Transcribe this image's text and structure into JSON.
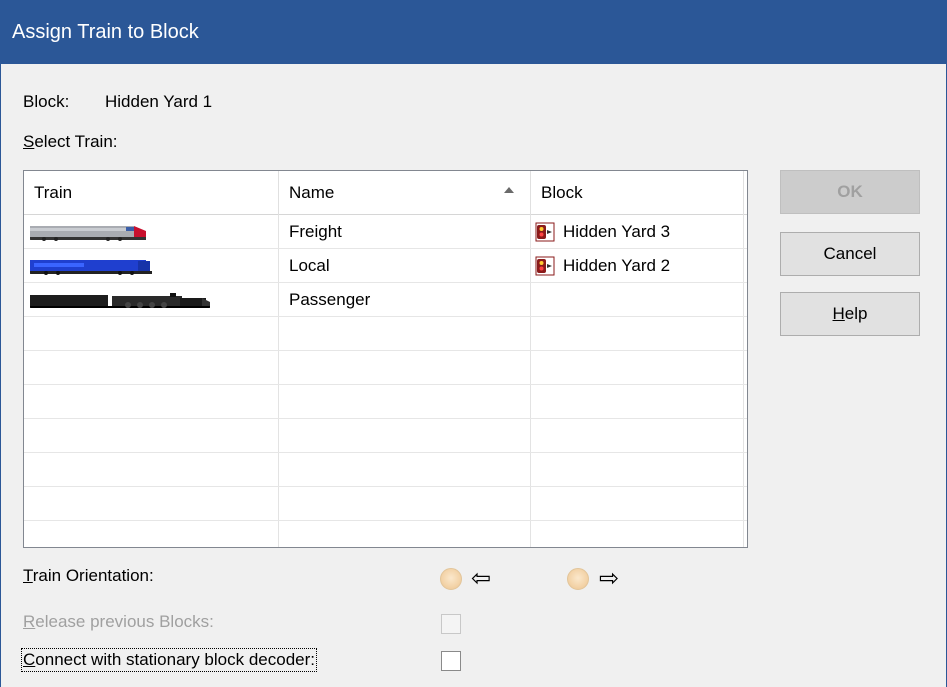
{
  "window": {
    "title": "Assign Train to Block"
  },
  "block_line": {
    "label": "Block:",
    "value": "Hidden Yard 1"
  },
  "select_train_label": "Select Train:",
  "table": {
    "columns": [
      "Train",
      "Name",
      "Block"
    ],
    "sort_column": "Name",
    "rows": [
      {
        "train_icon": "amtrak-diesel-locomotive-icon",
        "name": "Freight",
        "block": "Hidden Yard 3",
        "block_icon": "block-signal-icon"
      },
      {
        "train_icon": "blue-diesel-locomotive-icon",
        "name": "Local",
        "block": "Hidden Yard 2",
        "block_icon": "block-signal-icon"
      },
      {
        "train_icon": "black-steam-locomotive-icon",
        "name": "Passenger",
        "block": "",
        "block_icon": ""
      }
    ]
  },
  "buttons": {
    "ok": "OK",
    "cancel": "Cancel",
    "help": "Help"
  },
  "orientation": {
    "label": "Train Orientation:",
    "left_arrow": "⇦",
    "right_arrow": "⇨"
  },
  "release": {
    "label": "Release previous Blocks:"
  },
  "connect": {
    "label": "Connect with stationary block decoder:"
  },
  "colors": {
    "titlebar": "#2b5797",
    "radio_fill": "#f3d3a8"
  }
}
